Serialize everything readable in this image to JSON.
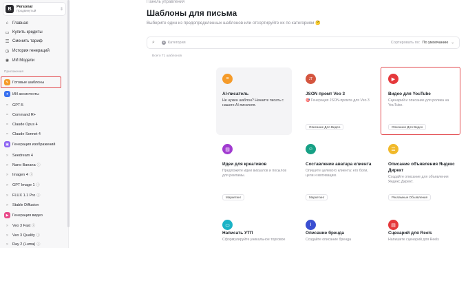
{
  "workspace": {
    "name": "Personal",
    "plan": "Продвинутый",
    "logo": "B"
  },
  "nav": [
    {
      "label": "Главная",
      "icon": "home-icon"
    },
    {
      "label": "Купить кредиты",
      "icon": "credit-card-icon"
    },
    {
      "label": "Сменить тариф",
      "icon": "plan-icon"
    },
    {
      "label": "История генераций",
      "icon": "history-icon"
    },
    {
      "label": "ИИ Модели",
      "icon": "models-icon"
    }
  ],
  "apps_section": "Приложения",
  "apps": [
    {
      "label": "Готовые шаблоны",
      "icon": "templates-icon",
      "color": "#f59b2a"
    },
    {
      "label": "ИИ ассистенты",
      "icon": "assistant-icon",
      "color": "#3a72f0"
    }
  ],
  "assistants": [
    "GPT-5",
    "Command R+",
    "Claude Opus 4",
    "Claude Sonnet 4"
  ],
  "image_cat": {
    "label": "Генерация изображений",
    "icon": "image-gen-icon",
    "color": "#8c63f2"
  },
  "image_models": [
    {
      "label": "Seedream 4",
      "info": false
    },
    {
      "label": "Nano Banana",
      "info": true
    },
    {
      "label": "Imagen 4",
      "info": true
    },
    {
      "label": "GPT Image 1",
      "info": true
    },
    {
      "label": "FLUX 1.1 Pro",
      "info": true
    },
    {
      "label": "Stable Diffusion",
      "info": false
    }
  ],
  "video_cat": {
    "label": "Генерация видео",
    "icon": "video-gen-icon",
    "color": "#e84a8a"
  },
  "video_models": [
    {
      "label": "Veo 3 Fast",
      "info": true
    },
    {
      "label": "Veo 3 Quality",
      "info": true
    },
    {
      "label": "Ray 2 (Luma)",
      "info": true
    }
  ],
  "breadcrumb": "Панель управления",
  "page_title": "Шаблоны для письма",
  "page_subtitle": "Выберите один из предопределенных шаблонов или отсортируйте их по категориям",
  "search": {
    "category_label": "Категория",
    "sort_label": "Сортировать по:",
    "sort_value": "По умолчанию"
  },
  "count_text": "Всего 71 шаблонов",
  "cards": [
    {
      "title": "AI-писатель",
      "desc": "Не нужен шаблон? Начните писать с нашего AI-писателя.",
      "tag": "",
      "icon": "pen-icon",
      "color": "#f59b2a"
    },
    {
      "title": "JSON промт Veo 3",
      "desc": "🎯 Генерация JSON-промта для Veo 3",
      "tag": "Описание Для Видео",
      "icon": "json-icon",
      "color": "#d4553f"
    },
    {
      "title": "Видео для YouTube",
      "desc": "Сценарий и описание для ролика на YouTube.",
      "tag": "Описание Для Видео",
      "icon": "play-icon",
      "color": "#e5383b"
    },
    {
      "title": "Идеи для креативов",
      "desc": "Предложите идеи визуалов и посылов для рекламы.",
      "tag": "Маркетинг",
      "icon": "image-icon",
      "color": "#a13bd0"
    },
    {
      "title": "Составление аватара клиента",
      "desc": "Опишите целевого клиента: его боли, цели и мотивацию.",
      "tag": "Маркетинг",
      "icon": "user-icon",
      "color": "#16a085"
    },
    {
      "title": "Описание объявления Яндекс Директ",
      "desc": "Создайте описание для объявления Яндекс.Директ.",
      "tag": "Рекламные Объявления",
      "icon": "list-icon",
      "color": "#f1b92a"
    },
    {
      "title": "Написать УТП",
      "desc": "Сформулируйте уникальное торговое",
      "tag": "",
      "icon": "screen-icon",
      "color": "#1bb3c6"
    },
    {
      "title": "Описание бренда",
      "desc": "Создайте описание бренда",
      "tag": "",
      "icon": "info-icon",
      "color": "#3a4fd1"
    },
    {
      "title": "Сценарий для Reels",
      "desc": "Напишите сценарий для Reels",
      "tag": "",
      "icon": "doc-icon",
      "color": "#e5383b"
    }
  ]
}
